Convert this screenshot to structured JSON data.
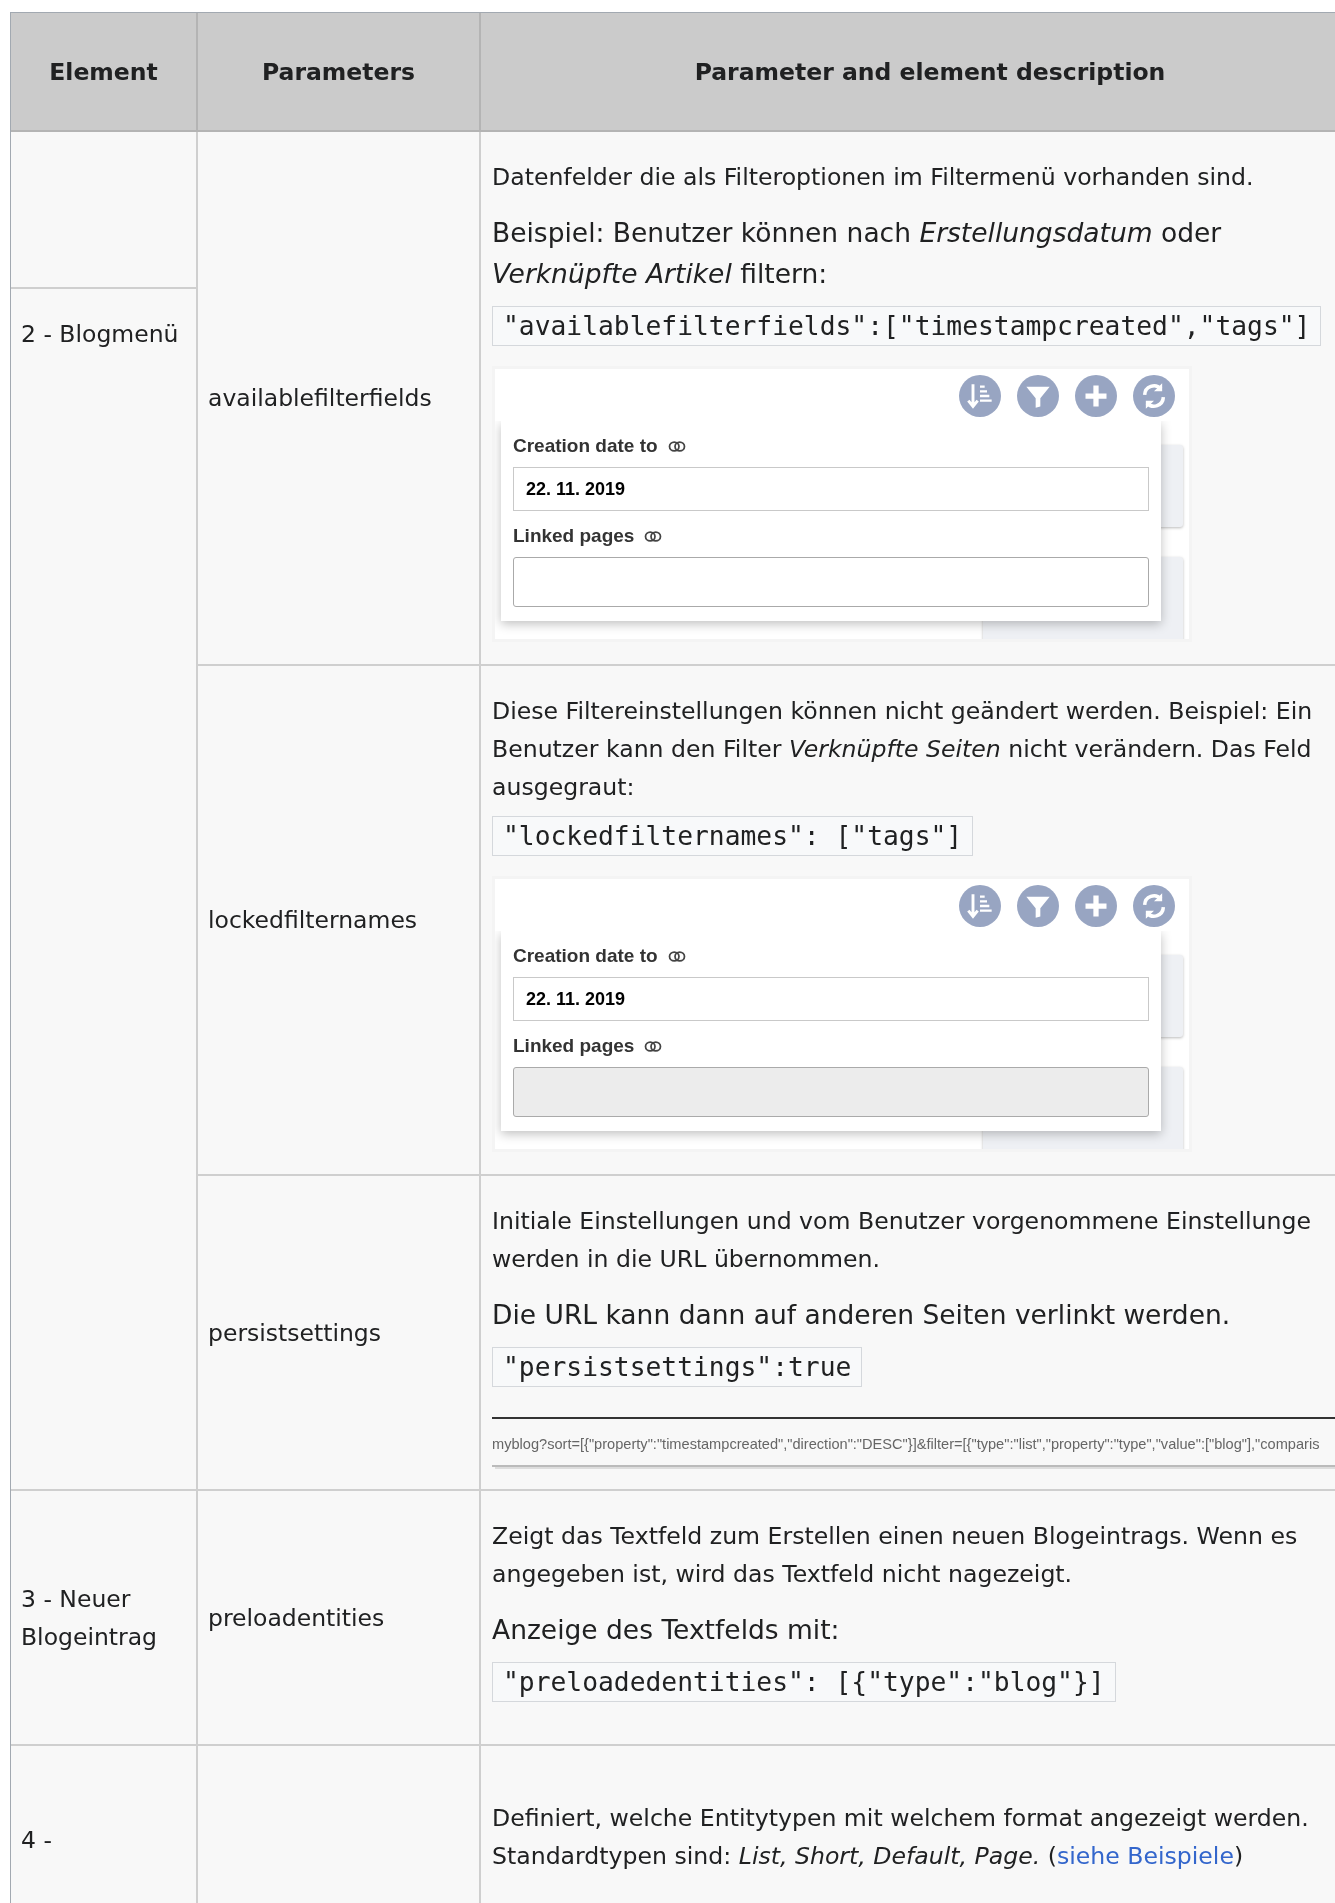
{
  "table": {
    "columns": [
      "Element",
      "Parameters",
      "Parameter and element description"
    ],
    "groups": [
      {
        "element": "2 - Blogmenü",
        "rows": [
          {
            "parameter": "availablefilterfields",
            "blocks": [
              {
                "kind": "text",
                "text": "Datenfelder die als Filteroptionen im Filtermenü vorhanden sind."
              },
              {
                "kind": "lead",
                "text": "Beispiel: Benutzer können nach *Erstellungsdatum* oder\n*Verknüpfte Artikel* filtern:"
              },
              {
                "kind": "code",
                "text": "\"availablefilterfields\":[\"timestampcreated\",\"tags\"]"
              },
              {
                "kind": "filter-screenshot",
                "fields": [
                  {
                    "label": "Creation date to",
                    "value": "22. 11. 2019",
                    "disabled": false
                  },
                  {
                    "label": "Linked pages",
                    "disabled": false
                  }
                ]
              }
            ]
          },
          {
            "parameter": "lockedfilternames",
            "blocks": [
              {
                "kind": "text",
                "text": "Diese Filtereinstellungen können nicht geändert werden. Beispiel: Ein\nBenutzer kann den Filter *Verknüpfte Seiten* nicht verändern. Das Feld\nausgegraut:"
              },
              {
                "kind": "code",
                "text": "\"lockedfilternames\": [\"tags\"]"
              },
              {
                "kind": "filter-screenshot",
                "fields": [
                  {
                    "label": "Creation date to",
                    "value": "22. 11. 2019",
                    "disabled": false
                  },
                  {
                    "label": "Linked pages",
                    "disabled": true
                  }
                ]
              }
            ]
          },
          {
            "parameter": "persistsettings",
            "blocks": [
              {
                "kind": "text",
                "text": "Initiale Einstellungen und vom Benutzer vorgenommene Einstellunge\nwerden in die URL übernommen."
              },
              {
                "kind": "lead",
                "text": "Die URL kann dann auf anderen Seiten verlinkt werden."
              },
              {
                "kind": "code",
                "text": "\"persistsettings\":true"
              },
              {
                "kind": "url-screenshot",
                "text": "myblog?sort=[{\"property\":\"timestampcreated\",\"direction\":\"DESC\"}]&filter=[{\"type\":\"list\",\"property\":\"type\",\"value\":[\"blog\"],\"comparis"
              }
            ]
          }
        ]
      },
      {
        "element": "3 - Neuer Blogeintrag",
        "rows": [
          {
            "parameter": "preloadentities",
            "blocks": [
              {
                "kind": "text",
                "text": "Zeigt das Textfeld zum Erstellen einen neuen Blogeintrags. Wenn es\nangegeben ist, wird das Textfeld nicht nagezeigt."
              },
              {
                "kind": "lead",
                "text": "Anzeige des Textfelds mit:"
              },
              {
                "kind": "code",
                "text": "\"preloadedentities\": [{\"type\":\"blog\"}]"
              }
            ]
          }
        ]
      },
      {
        "element": "4 -",
        "rows": [
          {
            "blocks": [
              {
                "kind": "text-link",
                "text": "Definiert, welche Entitytypen mit welchem format angezeigt werden.\nStandardtypen sind: *List, Short, Default, Page.* (",
                "link": "siehe Beispiele",
                "after": ")"
              }
            ]
          }
        ]
      }
    ]
  }
}
